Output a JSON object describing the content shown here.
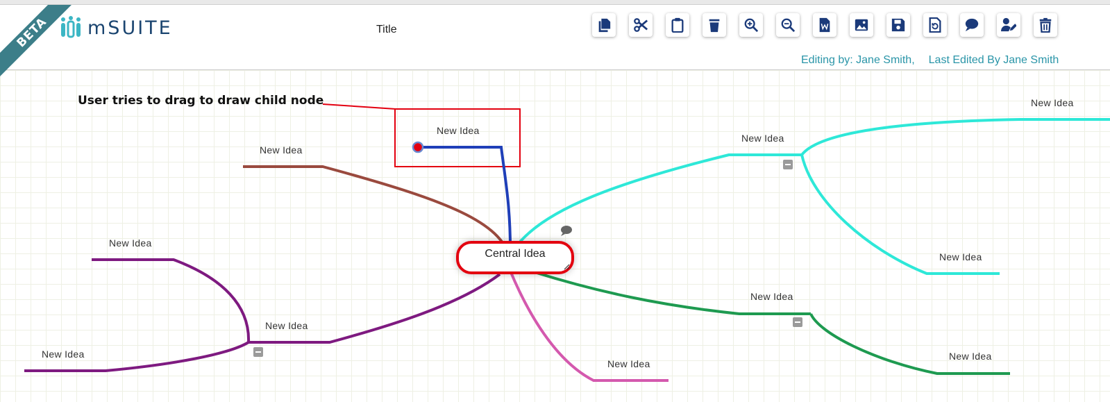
{
  "header": {
    "badge": "BETA",
    "logo_text": "mSUITE",
    "title": "Title",
    "toolbar": [
      {
        "name": "copy",
        "icon": "copy-icon"
      },
      {
        "name": "cut",
        "icon": "scissors-icon"
      },
      {
        "name": "paste",
        "icon": "clipboard-icon"
      },
      {
        "name": "delete",
        "icon": "trash-icon"
      },
      {
        "name": "zoom-in",
        "icon": "zoom-in-icon"
      },
      {
        "name": "zoom-out",
        "icon": "zoom-out-icon"
      },
      {
        "name": "export-word",
        "icon": "word-file-icon"
      },
      {
        "name": "export-image",
        "icon": "image-icon"
      },
      {
        "name": "save",
        "icon": "floppy-disk-icon"
      },
      {
        "name": "history",
        "icon": "file-history-icon"
      },
      {
        "name": "comments",
        "icon": "comment-icon"
      },
      {
        "name": "edit-user",
        "icon": "user-edit-icon"
      },
      {
        "name": "delete-all",
        "icon": "trash-alt-icon"
      }
    ],
    "editing_by": "Editing by: Jane Smith,",
    "last_edited": "Last Edited By Jane Smith"
  },
  "map": {
    "central": "Central Idea",
    "annotation": "User tries to drag to draw child node",
    "nodes": {
      "blue": "New Idea",
      "brown": "New Idea",
      "cyan_mid": "New Idea",
      "cyan_top": "New Idea",
      "cyan_bottom": "New Idea",
      "purple_mid": "New Idea",
      "purple_top": "New Idea",
      "purple_bottom": "New Idea",
      "green_mid": "New Idea",
      "green_bottom": "New Idea",
      "pink": "New Idea"
    }
  },
  "colors": {
    "brand": "#1b4570",
    "teal": "#2a95a8",
    "highlight": "#e3000f",
    "blue_branch": "#1f3fb8",
    "brown_branch": "#9a4a3e",
    "cyan_branch": "#2ee8d8",
    "purple_branch": "#7e1a80",
    "green_branch": "#1e9a50",
    "pink_branch": "#d459ae"
  }
}
